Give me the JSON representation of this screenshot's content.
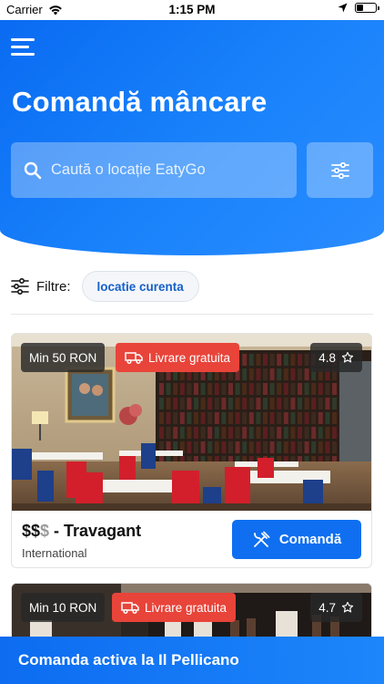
{
  "status_bar": {
    "carrier": "Carrier",
    "time": "1:15 PM",
    "battery_level": 0.35
  },
  "header": {
    "title": "Comandă mâncare",
    "search_placeholder": "Caută o locație EatyGo",
    "menu_icon": "menu-icon",
    "filter_icon": "sliders-icon"
  },
  "filters": {
    "label": "Filtre:",
    "chips": [
      "locatie curenta"
    ]
  },
  "restaurants": [
    {
      "min_order": "Min 50 RON",
      "free_delivery": "Livrare gratuita",
      "rating": "4.8",
      "price_active": "$$",
      "price_inactive": "$",
      "price_label": " - Travagant",
      "cuisine": "International",
      "order_label": "Comandă"
    },
    {
      "min_order": "Min 10 RON",
      "free_delivery": "Livrare gratuita",
      "rating": "4.7"
    }
  ],
  "bottom_bar": {
    "label": "Comanda activa la Il Pellicano"
  },
  "colors": {
    "primary": "#0f6ff0",
    "badge_red": "#e8443a",
    "chip_text": "#1560c9"
  }
}
